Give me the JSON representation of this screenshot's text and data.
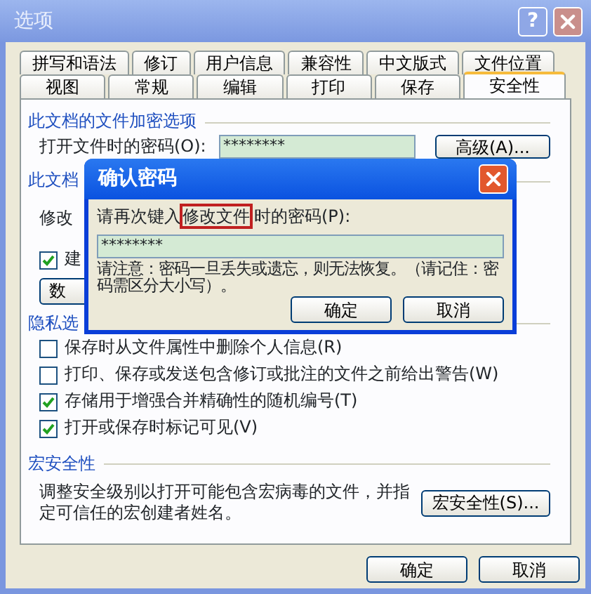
{
  "window": {
    "title": "选项",
    "help_button": "?"
  },
  "tab_rows": [
    [
      {
        "label": "拼写和语法",
        "selected": false
      },
      {
        "label": "修订",
        "selected": false
      },
      {
        "label": "用户信息",
        "selected": false
      },
      {
        "label": "兼容性",
        "selected": false
      },
      {
        "label": "中文版式",
        "selected": false
      },
      {
        "label": "文件位置",
        "selected": false
      }
    ],
    [
      {
        "label": "视图",
        "selected": false
      },
      {
        "label": "常规",
        "selected": false
      },
      {
        "label": "编辑",
        "selected": false
      },
      {
        "label": "打印",
        "selected": false
      },
      {
        "label": "保存",
        "selected": false
      },
      {
        "label": "安全性",
        "selected": true
      }
    ]
  ],
  "sections": [
    {
      "heading": "此文档的文件加密选项",
      "items": [
        {
          "kind": "password",
          "label": "打开文件时的密码(O):",
          "value": "********",
          "button": "高级(A)..."
        }
      ]
    },
    {
      "heading": "此文档",
      "items": [
        {
          "kind": "text",
          "text": "修改"
        },
        {
          "kind": "checkbox",
          "label": "建",
          "checked": true
        },
        {
          "kind": "button",
          "label": "数"
        }
      ]
    },
    {
      "heading": "隐私选",
      "items": [
        {
          "kind": "checkbox",
          "label": "保存时从文件属性中删除个人信息(R)",
          "checked": false
        },
        {
          "kind": "checkbox",
          "label": "打印、保存或发送包含修订或批注的文件之前给出警告(W)",
          "checked": false
        },
        {
          "kind": "checkbox",
          "label": "存储用于增强合并精确性的随机编号(T)",
          "checked": true
        },
        {
          "kind": "checkbox",
          "label": "打开或保存时标记可见(V)",
          "checked": true
        }
      ]
    },
    {
      "heading": "宏安全性",
      "items": [
        {
          "kind": "text_button",
          "text": "调整安全级别以打开可能包含宏病毒的文件，并指定可信任的宏创建者姓名。",
          "button": "宏安全性(S)..."
        }
      ]
    }
  ],
  "buttons": [
    "确定",
    "取消"
  ],
  "dialog": {
    "title": "确认密码",
    "prompt": [
      {
        "text": "请再次键入",
        "highlighted": false
      },
      {
        "text": "修改文件",
        "highlighted": true
      },
      {
        "text": "时的密码(P):",
        "highlighted": false
      }
    ],
    "value": "********",
    "note": "请注意：密码一旦丢失或遗忘，则无法恢复。（请记住：密码需区分大小写）。",
    "buttons": [
      "确定",
      "取消"
    ]
  }
}
